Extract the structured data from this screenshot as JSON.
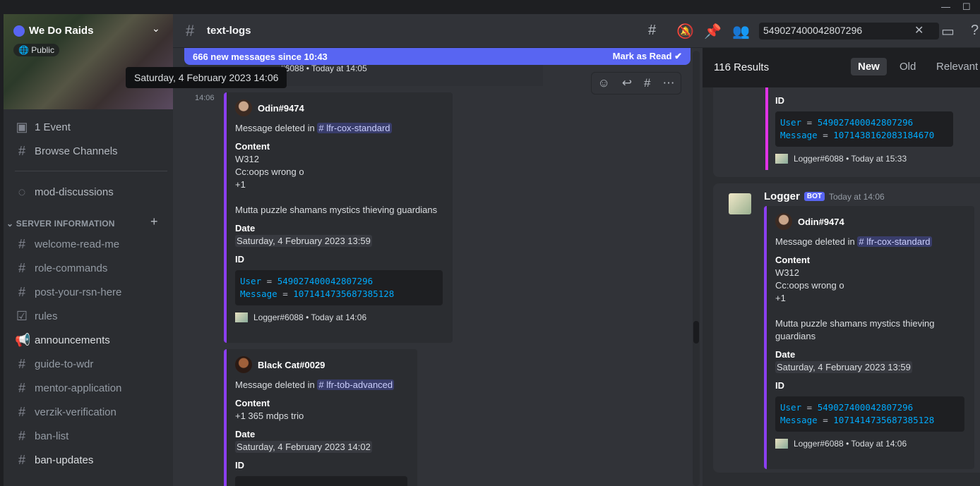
{
  "window": {
    "minimize": "—",
    "maximize": "☐"
  },
  "server": {
    "name": "We Do Raids",
    "badge": "Public"
  },
  "sidebar": {
    "top_items": [
      {
        "label": "1 Event",
        "icon": "calendar-icon"
      },
      {
        "label": "Browse Channels",
        "icon": "browse-channels-icon"
      }
    ],
    "mod_channel": {
      "label": "mod-discussions",
      "icon": "forum-icon"
    },
    "category": "SERVER INFORMATION",
    "channels": [
      {
        "label": "welcome-read-me",
        "icon": "hash-icon"
      },
      {
        "label": "role-commands",
        "icon": "hash-icon"
      },
      {
        "label": "post-your-rsn-here",
        "icon": "hash-icon"
      },
      {
        "label": "rules",
        "icon": "rules-icon"
      },
      {
        "label": "announcements",
        "icon": "megaphone-icon",
        "unread": true
      },
      {
        "label": "guide-to-wdr",
        "icon": "hash-icon"
      },
      {
        "label": "mentor-application",
        "icon": "hash-icon"
      },
      {
        "label": "verzik-verification",
        "icon": "hash-icon"
      },
      {
        "label": "ban-list",
        "icon": "hash-icon"
      },
      {
        "label": "ban-updates",
        "icon": "hash-icon",
        "unread": true
      }
    ]
  },
  "header": {
    "channel": "text-logs",
    "search_value": "549027400042807296"
  },
  "banner": {
    "text": "666 new messages since 10:43",
    "action": "Mark as Read"
  },
  "tooltip": "Saturday, 4 February 2023 14:06",
  "messages": {
    "prev_footer": "#6088 • Today at 14:05",
    "timestamp": "14:06",
    "embeds": [
      {
        "author": "Odin#9474",
        "deleted_in": "Message deleted in ",
        "channel": "lfr-cox-standard",
        "content_label": "Content",
        "content": [
          "W312",
          "Cc:oops wrong o",
          "+1",
          "",
          "Mutta puzzle shamans mystics thieving guardians"
        ],
        "date_label": "Date",
        "date": "Saturday, 4 February 2023 13:59",
        "id_label": "ID",
        "user_key": "User",
        "user_id": "549027400042807296",
        "msg_key": "Message",
        "msg_id": "1071414735687385128",
        "footer": "Logger#6088 • Today at 14:06"
      },
      {
        "author": "Black Cat#0029",
        "deleted_in": "Message deleted in ",
        "channel": "lfr-tob-advanced",
        "content_label": "Content",
        "content": [
          "+1 365 mdps trio"
        ],
        "date_label": "Date",
        "date": "Saturday, 4 February 2023 14:02",
        "id_label": "ID"
      }
    ]
  },
  "results": {
    "count": "116 Results",
    "tabs": [
      "New",
      "Old",
      "Relevant"
    ],
    "active_tab": "New",
    "first": {
      "id_label": "ID",
      "user_key": "User",
      "user_id": "549027400042807296",
      "msg_key": "Message",
      "msg_id": "1071438162083184670",
      "footer": "Logger#6088 • Today at 15:33"
    },
    "second": {
      "bot_name": "Logger",
      "bot_tag": "BOT",
      "time": "Today at 14:06",
      "author": "Odin#9474",
      "deleted_in": "Message deleted in ",
      "channel": "lfr-cox-standard",
      "content_label": "Content",
      "content": [
        "W312",
        "Cc:oops wrong o",
        "+1",
        "",
        "Mutta puzzle shamans mystics thieving",
        "guardians"
      ],
      "date_label": "Date",
      "date": "Saturday, 4 February 2023 13:59",
      "id_label": "ID",
      "user_key": "User",
      "user_id": "549027400042807296",
      "msg_key": "Message",
      "msg_id": "1071414735687385128",
      "footer": "Logger#6088 • Today at 14:06"
    }
  },
  "colors": {
    "accent": "#5865f2",
    "embed_purple": "#8b3ff0",
    "embed_magenta": "#e033e6",
    "code_blue": "#00aafc"
  }
}
